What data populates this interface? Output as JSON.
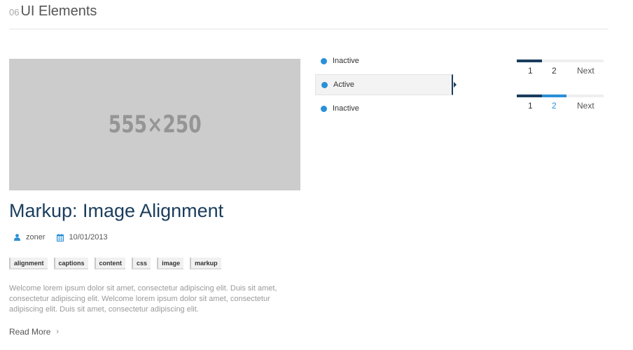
{
  "section": {
    "number": "06",
    "title": "UI Elements"
  },
  "image_placeholder": {
    "label": "555×250"
  },
  "post": {
    "title": "Markup: Image Alignment",
    "author": "zoner",
    "date": "10/01/2013",
    "tags": [
      "alignment",
      "captions",
      "content",
      "css",
      "image",
      "markup"
    ],
    "excerpt": "Welcome lorem ipsum dolor sit amet, consectetur adipiscing elit. Duis sit amet, consectetur adipiscing elit. Welcome lorem ipsum dolor sit amet, consectetur adipiscing elit. Duis sit amet, consectetur adipiscing elit.",
    "read_more": "Read More",
    "read_more_icon": "chevron-right-icon"
  },
  "tabs": [
    {
      "label": "Inactive",
      "active": false
    },
    {
      "label": "Active",
      "active": true
    },
    {
      "label": "Inactive",
      "active": false
    }
  ],
  "pagers": [
    {
      "pages": [
        "1",
        "2"
      ],
      "next": "Next",
      "current_page": "1"
    },
    {
      "pages": [
        "1",
        "2"
      ],
      "next": "Next",
      "current_page": "2"
    }
  ],
  "colors": {
    "accent_blue": "#2a8fd6",
    "navy": "#1a3d5c",
    "placeholder_bg": "#cccccc"
  }
}
